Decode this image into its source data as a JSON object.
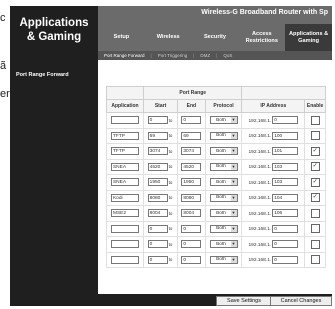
{
  "bleed_left": [
    "c",
    "ã",
    "er"
  ],
  "header": {
    "section_title_line1": "Applications",
    "section_title_line2": "& Gaming",
    "router_title": "Wireless-G Broadband Router with Sp"
  },
  "tabs": [
    {
      "label": "Setup",
      "active": false
    },
    {
      "label": "Wireless",
      "active": false
    },
    {
      "label": "Security",
      "active": false
    },
    {
      "label": "Access Restrictions",
      "active": false
    },
    {
      "label": "Applications & Gaming",
      "active": true
    }
  ],
  "subtabs": [
    {
      "label": "Port Range Forward",
      "active": true
    },
    {
      "label": "Port Triggering",
      "active": false
    },
    {
      "label": "DMZ",
      "active": false
    },
    {
      "label": "QoS",
      "active": false
    }
  ],
  "sidebar": {
    "item": "Port Range Forward"
  },
  "table": {
    "group_header": "Port Range",
    "headers": {
      "application": "Application",
      "start": "Start",
      "end": "End",
      "protocol": "Protocol",
      "ip_address": "IP Address",
      "enable": "Enable"
    },
    "to_label": "to",
    "ip_prefix": "192.168.1.",
    "rows": [
      {
        "application": "",
        "start": "0",
        "end": "0",
        "protocol": "Both",
        "ip": "0",
        "enabled": false
      },
      {
        "application": "TFTP",
        "start": "69",
        "end": "69",
        "protocol": "Both",
        "ip": "100",
        "enabled": false
      },
      {
        "application": "TFTP",
        "start": "3074",
        "end": "3074",
        "protocol": "Both",
        "ip": "101",
        "enabled": true
      },
      {
        "application": "SNEA",
        "start": "4520",
        "end": "4520",
        "protocol": "Both",
        "ip": "103",
        "enabled": true
      },
      {
        "application": "SNEA",
        "start": "1950",
        "end": "1950",
        "protocol": "Both",
        "ip": "103",
        "enabled": true
      },
      {
        "application": "Kodi",
        "start": "8080",
        "end": "8080",
        "protocol": "Both",
        "ip": "104",
        "enabled": true
      },
      {
        "application": "MSE2",
        "start": "8004",
        "end": "8004",
        "protocol": "Both",
        "ip": "106",
        "enabled": false
      },
      {
        "application": "",
        "start": "0",
        "end": "0",
        "protocol": "Both",
        "ip": "0",
        "enabled": false
      },
      {
        "application": "",
        "start": "0",
        "end": "0",
        "protocol": "Both",
        "ip": "0",
        "enabled": false
      },
      {
        "application": "",
        "start": "0",
        "end": "0",
        "protocol": "Both",
        "ip": "0",
        "enabled": false
      }
    ]
  },
  "footer": {
    "save_label": "Save Settings",
    "cancel_label": "Cancel Changes"
  },
  "colors": {
    "dark_chrome": "#1f1f1f",
    "header_gray": "#6b6b6b",
    "active_tab": "#3a3a3a"
  }
}
